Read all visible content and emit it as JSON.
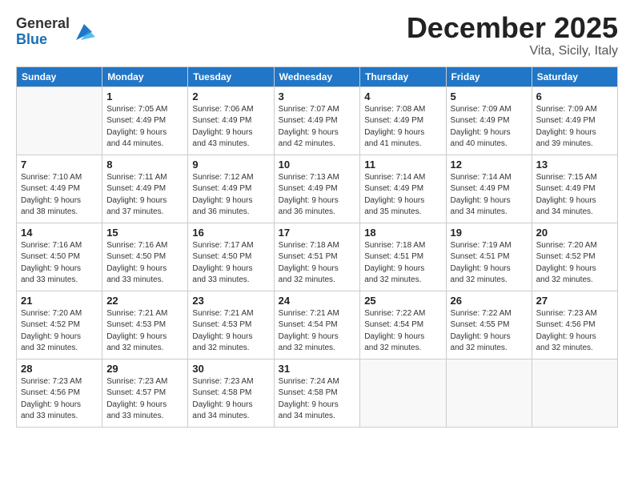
{
  "logo": {
    "general": "General",
    "blue": "Blue"
  },
  "title": "December 2025",
  "location": "Vita, Sicily, Italy",
  "days_header": [
    "Sunday",
    "Monday",
    "Tuesday",
    "Wednesday",
    "Thursday",
    "Friday",
    "Saturday"
  ],
  "weeks": [
    [
      {
        "day": "",
        "info": ""
      },
      {
        "day": "1",
        "info": "Sunrise: 7:05 AM\nSunset: 4:49 PM\nDaylight: 9 hours\nand 44 minutes."
      },
      {
        "day": "2",
        "info": "Sunrise: 7:06 AM\nSunset: 4:49 PM\nDaylight: 9 hours\nand 43 minutes."
      },
      {
        "day": "3",
        "info": "Sunrise: 7:07 AM\nSunset: 4:49 PM\nDaylight: 9 hours\nand 42 minutes."
      },
      {
        "day": "4",
        "info": "Sunrise: 7:08 AM\nSunset: 4:49 PM\nDaylight: 9 hours\nand 41 minutes."
      },
      {
        "day": "5",
        "info": "Sunrise: 7:09 AM\nSunset: 4:49 PM\nDaylight: 9 hours\nand 40 minutes."
      },
      {
        "day": "6",
        "info": "Sunrise: 7:09 AM\nSunset: 4:49 PM\nDaylight: 9 hours\nand 39 minutes."
      }
    ],
    [
      {
        "day": "7",
        "info": "Sunrise: 7:10 AM\nSunset: 4:49 PM\nDaylight: 9 hours\nand 38 minutes."
      },
      {
        "day": "8",
        "info": "Sunrise: 7:11 AM\nSunset: 4:49 PM\nDaylight: 9 hours\nand 37 minutes."
      },
      {
        "day": "9",
        "info": "Sunrise: 7:12 AM\nSunset: 4:49 PM\nDaylight: 9 hours\nand 36 minutes."
      },
      {
        "day": "10",
        "info": "Sunrise: 7:13 AM\nSunset: 4:49 PM\nDaylight: 9 hours\nand 36 minutes."
      },
      {
        "day": "11",
        "info": "Sunrise: 7:14 AM\nSunset: 4:49 PM\nDaylight: 9 hours\nand 35 minutes."
      },
      {
        "day": "12",
        "info": "Sunrise: 7:14 AM\nSunset: 4:49 PM\nDaylight: 9 hours\nand 34 minutes."
      },
      {
        "day": "13",
        "info": "Sunrise: 7:15 AM\nSunset: 4:49 PM\nDaylight: 9 hours\nand 34 minutes."
      }
    ],
    [
      {
        "day": "14",
        "info": "Sunrise: 7:16 AM\nSunset: 4:50 PM\nDaylight: 9 hours\nand 33 minutes."
      },
      {
        "day": "15",
        "info": "Sunrise: 7:16 AM\nSunset: 4:50 PM\nDaylight: 9 hours\nand 33 minutes."
      },
      {
        "day": "16",
        "info": "Sunrise: 7:17 AM\nSunset: 4:50 PM\nDaylight: 9 hours\nand 33 minutes."
      },
      {
        "day": "17",
        "info": "Sunrise: 7:18 AM\nSunset: 4:51 PM\nDaylight: 9 hours\nand 32 minutes."
      },
      {
        "day": "18",
        "info": "Sunrise: 7:18 AM\nSunset: 4:51 PM\nDaylight: 9 hours\nand 32 minutes."
      },
      {
        "day": "19",
        "info": "Sunrise: 7:19 AM\nSunset: 4:51 PM\nDaylight: 9 hours\nand 32 minutes."
      },
      {
        "day": "20",
        "info": "Sunrise: 7:20 AM\nSunset: 4:52 PM\nDaylight: 9 hours\nand 32 minutes."
      }
    ],
    [
      {
        "day": "21",
        "info": "Sunrise: 7:20 AM\nSunset: 4:52 PM\nDaylight: 9 hours\nand 32 minutes."
      },
      {
        "day": "22",
        "info": "Sunrise: 7:21 AM\nSunset: 4:53 PM\nDaylight: 9 hours\nand 32 minutes."
      },
      {
        "day": "23",
        "info": "Sunrise: 7:21 AM\nSunset: 4:53 PM\nDaylight: 9 hours\nand 32 minutes."
      },
      {
        "day": "24",
        "info": "Sunrise: 7:21 AM\nSunset: 4:54 PM\nDaylight: 9 hours\nand 32 minutes."
      },
      {
        "day": "25",
        "info": "Sunrise: 7:22 AM\nSunset: 4:54 PM\nDaylight: 9 hours\nand 32 minutes."
      },
      {
        "day": "26",
        "info": "Sunrise: 7:22 AM\nSunset: 4:55 PM\nDaylight: 9 hours\nand 32 minutes."
      },
      {
        "day": "27",
        "info": "Sunrise: 7:23 AM\nSunset: 4:56 PM\nDaylight: 9 hours\nand 32 minutes."
      }
    ],
    [
      {
        "day": "28",
        "info": "Sunrise: 7:23 AM\nSunset: 4:56 PM\nDaylight: 9 hours\nand 33 minutes."
      },
      {
        "day": "29",
        "info": "Sunrise: 7:23 AM\nSunset: 4:57 PM\nDaylight: 9 hours\nand 33 minutes."
      },
      {
        "day": "30",
        "info": "Sunrise: 7:23 AM\nSunset: 4:58 PM\nDaylight: 9 hours\nand 34 minutes."
      },
      {
        "day": "31",
        "info": "Sunrise: 7:24 AM\nSunset: 4:58 PM\nDaylight: 9 hours\nand 34 minutes."
      },
      {
        "day": "",
        "info": ""
      },
      {
        "day": "",
        "info": ""
      },
      {
        "day": "",
        "info": ""
      }
    ]
  ]
}
